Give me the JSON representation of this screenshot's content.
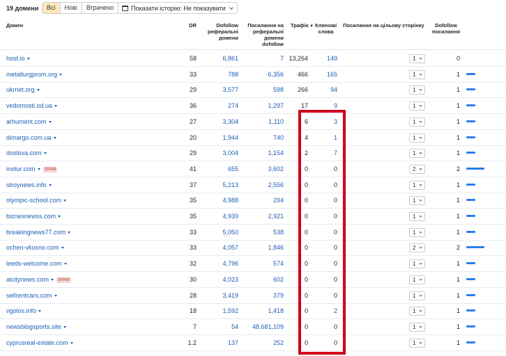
{
  "toolbar": {
    "count_label": "19 домени",
    "tabs": [
      "Всі",
      "Нові",
      "Втрачено"
    ],
    "history_label": "Показати історію: Не показувати"
  },
  "columns": {
    "domain": "Домен",
    "dr": "DR",
    "ref_domains": [
      "Dofollow",
      "реферальні",
      "домени"
    ],
    "backlinks": [
      "Посилання на",
      "реферальні",
      "домени",
      "dofollow"
    ],
    "traffic": "Трафік",
    "keywords": [
      "Ключові",
      "слова"
    ],
    "target": "Посилання на цільову сторінку",
    "dofollow": [
      "Dofollow",
      "посилання"
    ]
  },
  "spam_label": "SPAM",
  "colors": {
    "accent": "#1a5fb4",
    "bar": "#2b7de9",
    "highlight": "#d0021b",
    "active_tab": "#fde6b8"
  },
  "rows": [
    {
      "domain": "host.io",
      "spam": false,
      "dr": "58",
      "ref": "6,861",
      "back": "7",
      "traffic": "13,264",
      "kw": "149",
      "target": "1",
      "df": "0",
      "bar": 0
    },
    {
      "domain": "metallurgprom.org",
      "spam": false,
      "dr": "33",
      "ref": "788",
      "back": "6,356",
      "traffic": "466",
      "kw": "165",
      "target": "1",
      "df": "1",
      "bar": 1
    },
    {
      "domain": "ukrnet.org",
      "spam": false,
      "dr": "29",
      "ref": "3,577",
      "back": "598",
      "traffic": "266",
      "kw": "94",
      "target": "1",
      "df": "1",
      "bar": 1
    },
    {
      "domain": "vedomosti.od.ua",
      "spam": false,
      "dr": "36",
      "ref": "274",
      "back": "1,297",
      "traffic": "17",
      "kw": "9",
      "target": "1",
      "df": "1",
      "bar": 1
    },
    {
      "domain": "arhument.com",
      "spam": false,
      "dr": "27",
      "ref": "3,304",
      "back": "1,110",
      "traffic": "6",
      "kw": "3",
      "target": "1",
      "df": "1",
      "bar": 1
    },
    {
      "domain": "dimargo.com.ua",
      "spam": false,
      "dr": "20",
      "ref": "1,944",
      "back": "740",
      "traffic": "4",
      "kw": "1",
      "target": "1",
      "df": "1",
      "bar": 1
    },
    {
      "domain": "doslova.com",
      "spam": false,
      "dr": "29",
      "ref": "3,004",
      "back": "1,154",
      "traffic": "2",
      "kw": "7",
      "target": "1",
      "df": "1",
      "bar": 1
    },
    {
      "domain": "inotur.com",
      "spam": true,
      "dr": "41",
      "ref": "655",
      "back": "3,602",
      "traffic": "0",
      "kw": "0",
      "target": "2",
      "df": "2",
      "bar": 2
    },
    {
      "domain": "stroynews.info",
      "spam": false,
      "dr": "37",
      "ref": "5,213",
      "back": "2,556",
      "traffic": "0",
      "kw": "0",
      "target": "1",
      "df": "1",
      "bar": 1
    },
    {
      "domain": "olympic-school.com",
      "spam": false,
      "dr": "35",
      "ref": "4,988",
      "back": "294",
      "traffic": "0",
      "kw": "0",
      "target": "1",
      "df": "1",
      "bar": 1
    },
    {
      "domain": "biznesnewss.com",
      "spam": false,
      "dr": "35",
      "ref": "4,939",
      "back": "2,921",
      "traffic": "0",
      "kw": "0",
      "target": "1",
      "df": "1",
      "bar": 1
    },
    {
      "domain": "breakingnews77.com",
      "spam": false,
      "dr": "33",
      "ref": "5,050",
      "back": "538",
      "traffic": "0",
      "kw": "0",
      "target": "1",
      "df": "1",
      "bar": 1
    },
    {
      "domain": "ochen-vkusno.com",
      "spam": false,
      "dr": "33",
      "ref": "4,057",
      "back": "1,846",
      "traffic": "0",
      "kw": "0",
      "target": "2",
      "df": "2",
      "bar": 2
    },
    {
      "domain": "leeds-welcome.com",
      "spam": false,
      "dr": "32",
      "ref": "4,796",
      "back": "574",
      "traffic": "0",
      "kw": "0",
      "target": "1",
      "df": "1",
      "bar": 1
    },
    {
      "domain": "alcitynews.com",
      "spam": true,
      "dr": "30",
      "ref": "4,023",
      "back": "602",
      "traffic": "0",
      "kw": "0",
      "target": "1",
      "df": "1",
      "bar": 1
    },
    {
      "domain": "sellrentcars.com",
      "spam": false,
      "dr": "28",
      "ref": "3,419",
      "back": "379",
      "traffic": "0",
      "kw": "0",
      "target": "1",
      "df": "1",
      "bar": 1
    },
    {
      "domain": "vgolos.info",
      "spam": false,
      "dr": "18",
      "ref": "1,592",
      "back": "1,418",
      "traffic": "0",
      "kw": "2",
      "target": "1",
      "df": "1",
      "bar": 1
    },
    {
      "domain": "newsblogsports.site",
      "spam": false,
      "dr": "7",
      "ref": "54",
      "back": "48,681,109",
      "traffic": "0",
      "kw": "0",
      "target": "1",
      "df": "1",
      "bar": 1
    },
    {
      "domain": "cyprusreal-estate.com",
      "spam": false,
      "dr": "1.2",
      "ref": "137",
      "back": "252",
      "traffic": "0",
      "kw": "0",
      "target": "1",
      "df": "1",
      "bar": 1
    }
  ]
}
